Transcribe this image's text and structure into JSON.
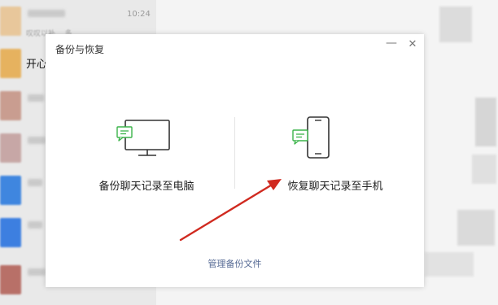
{
  "background": {
    "chat_list": {
      "items": [
        {
          "time": "10:24",
          "snippet": "叹叹以补... 多"
        },
        {
          "name": "开心"
        }
      ]
    }
  },
  "dialog": {
    "title": "备份与恢复",
    "minimize_icon": "minimize-icon",
    "close_icon": "close-icon",
    "options": [
      {
        "label": "备份聊天记录至电脑",
        "icon": "monitor-chat-icon"
      },
      {
        "label": "恢复聊天记录至手机",
        "icon": "phone-chat-icon"
      }
    ],
    "manage_link": "管理备份文件"
  },
  "colors": {
    "accent_green": "#3bb44a",
    "link": "#576b95",
    "arrow": "#d02a20"
  }
}
